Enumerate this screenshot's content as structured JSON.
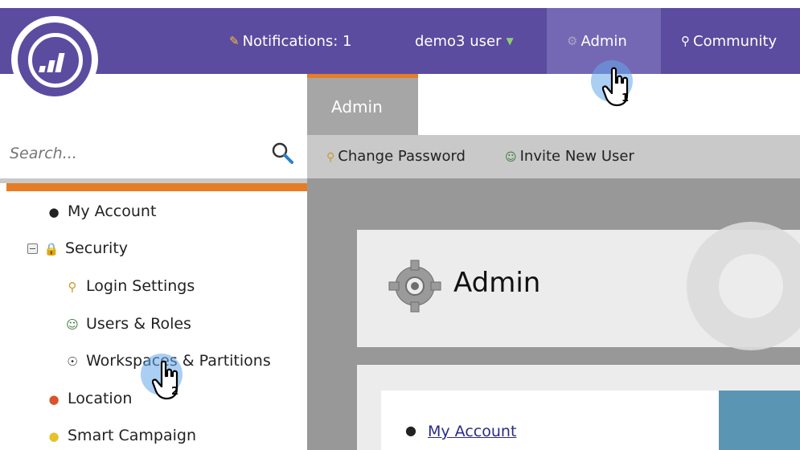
{
  "app": {
    "logo_name": "marketo-logo"
  },
  "topnav": {
    "notifications": {
      "label": "Notifications: 1",
      "icon": "notification-icon"
    },
    "user": {
      "label": "demo3 user",
      "icon": "caret-icon"
    },
    "admin": {
      "label": "Admin",
      "icon": "gear-icon"
    },
    "community": {
      "label": "Community",
      "icon": "community-icon"
    }
  },
  "cursors": [
    {
      "number": "1"
    },
    {
      "number": "2"
    }
  ],
  "sidebar": {
    "search_placeholder": "Search...",
    "items": [
      {
        "label": "My Account",
        "icon": "user-icon"
      },
      {
        "label": "Security",
        "icon": "lock-icon"
      },
      {
        "label": "Login Settings",
        "icon": "key-icon"
      },
      {
        "label": "Users & Roles",
        "icon": "users-icon"
      },
      {
        "label": "Workspaces & Partitions",
        "icon": "globe-icon"
      },
      {
        "label": "Location",
        "icon": "location-icon"
      },
      {
        "label": "Smart Campaign",
        "icon": "lightbulb-icon"
      }
    ]
  },
  "main": {
    "tab": "Admin",
    "toolbar": [
      {
        "label": "Change Password",
        "icon": "key-icon"
      },
      {
        "label": "Invite New User",
        "icon": "invite-user-icon"
      }
    ],
    "page_title": "Admin",
    "link": "My Account"
  },
  "colors": {
    "topbar": "#5c4c9f",
    "accent_orange": "#e67d26",
    "admin_highlight": "#7468b4"
  }
}
